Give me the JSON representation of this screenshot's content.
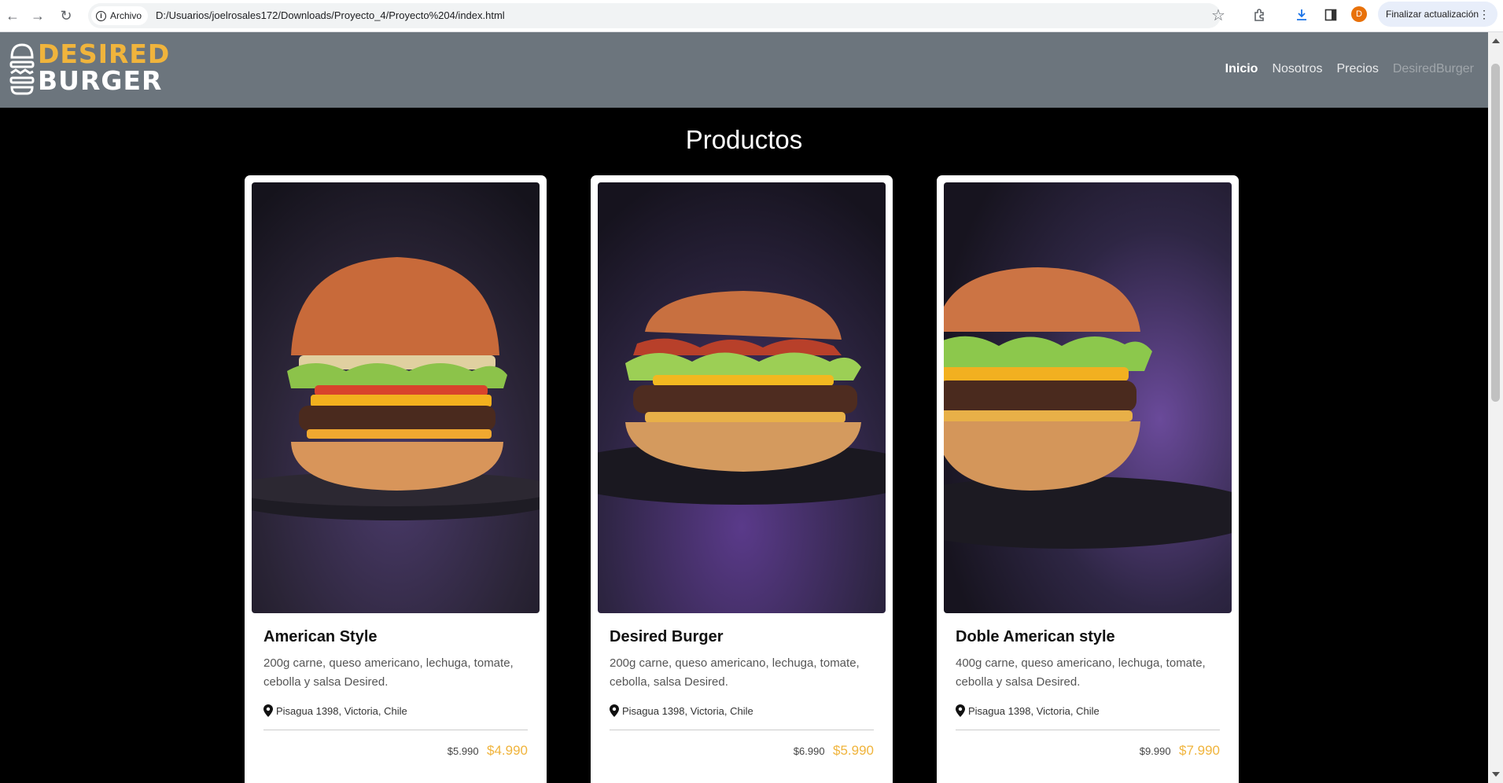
{
  "browser": {
    "site_chip": "Archivo",
    "url": "D:/Usuarios/joelrosales172/Downloads/Proyecto_4/Proyecto%204/index.html",
    "profile_initial": "D",
    "update_button": "Finalizar actualización"
  },
  "header": {
    "logo_top": "DESIRED",
    "logo_bottom": "BURGER",
    "nav": [
      {
        "label": "Inicio"
      },
      {
        "label": "Nosotros"
      },
      {
        "label": "Precios"
      },
      {
        "label": "DesiredBurger"
      }
    ]
  },
  "products": {
    "title": "Productos",
    "items": [
      {
        "name": "American Style",
        "description": "200g carne, queso americano, lechuga, tomate, cebolla y salsa Desired.",
        "location": "Pisagua 1398, Victoria, Chile",
        "old_price": "$5.990",
        "price": "$4.990"
      },
      {
        "name": "Desired Burger",
        "description": "200g carne, queso americano, lechuga, tomate, cebolla, salsa Desired.",
        "location": "Pisagua 1398, Victoria, Chile",
        "old_price": "$6.990",
        "price": "$5.990"
      },
      {
        "name": "Doble American style",
        "description": "400g carne, queso americano, lechuga, tomate, cebolla y salsa Desired.",
        "location": "Pisagua 1398, Victoria, Chile",
        "old_price": "$9.990",
        "price": "$7.990"
      }
    ]
  },
  "colors": {
    "accent": "#f0b43c",
    "header_bg": "#6c757d"
  }
}
